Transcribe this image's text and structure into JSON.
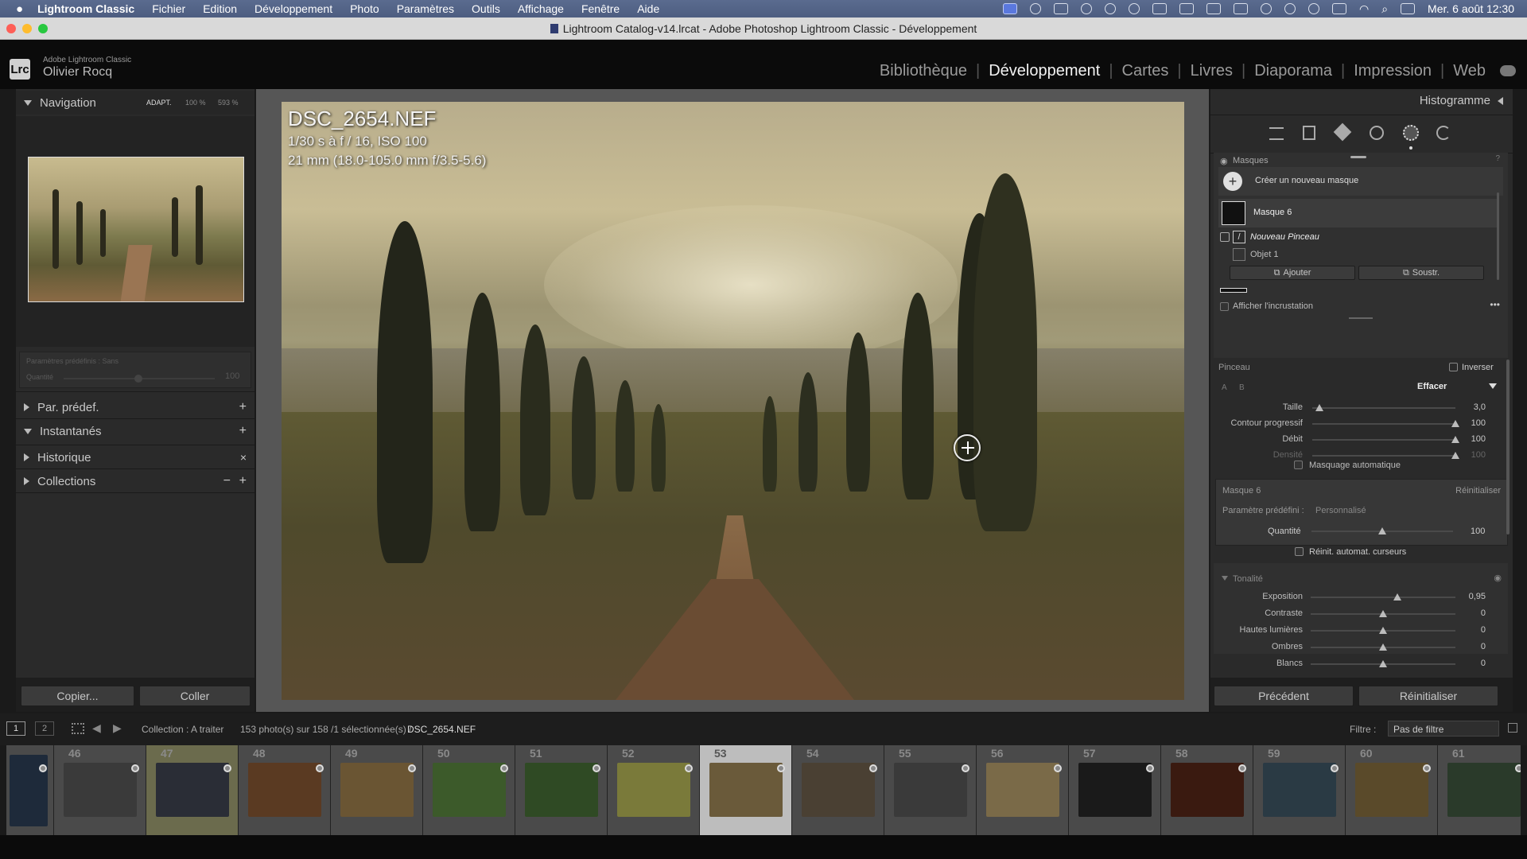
{
  "menubar": {
    "app": "Lightroom Classic",
    "items": [
      "Fichier",
      "Edition",
      "Développement",
      "Photo",
      "Paramètres",
      "Outils",
      "Affichage",
      "Fenêtre",
      "Aide"
    ],
    "clock": "Mer. 6 août  12:30"
  },
  "window": {
    "title": "Lightroom Catalog-v14.lrcat - Adobe Photoshop Lightroom Classic - Développement"
  },
  "brand": {
    "logo": "Lrc",
    "product": "Adobe Lightroom Classic",
    "user": "Olivier Rocq"
  },
  "modules": [
    "Bibliothèque",
    "Développement",
    "Cartes",
    "Livres",
    "Diaporama",
    "Impression",
    "Web"
  ],
  "active_module": "Développement",
  "left_panel": {
    "navigation": {
      "title": "Navigation",
      "zoom1": "ADAPT.",
      "zoom2": "100 %",
      "zoom3": "593 %"
    },
    "preset_dim": {
      "label": "Paramètres prédéfinis : Sans",
      "amount_label": "Quantité",
      "amount_value": "100"
    },
    "sections": [
      {
        "label": "Par. prédef.",
        "action": "+"
      },
      {
        "label": "Instantanés",
        "action": "+"
      },
      {
        "label": "Historique",
        "action": "×"
      },
      {
        "label": "Collections",
        "action": "+"
      }
    ],
    "copy_button": "Copier...",
    "paste_button": "Coller"
  },
  "photo": {
    "filename": "DSC_2654.NEF",
    "exposure": "1/30 s à f / 16, ISO 100",
    "lens": "21 mm (18.0-105.0 mm f/3.5-5.6)"
  },
  "right_panel": {
    "histogram": "Histogramme",
    "masks_title": "Masques",
    "create_mask": "Créer un nouveau masque",
    "mask_name": "Masque 6",
    "brush_name": "Nouveau Pinceau",
    "object": "Objet 1",
    "add": "Ajouter",
    "subtract": "Soustr.",
    "overlay": "Afficher l'incrustation",
    "brush": {
      "title": "Pinceau",
      "invert": "Inverser",
      "a": "A",
      "b": "B",
      "mode": "Effacer",
      "sliders": [
        {
          "label": "Taille",
          "value": "3,0",
          "pos": 0.05
        },
        {
          "label": "Contour progressif",
          "value": "100",
          "pos": 1.0
        },
        {
          "label": "Débit",
          "value": "100",
          "pos": 1.0
        },
        {
          "label": "Densité",
          "value": "100",
          "pos": 1.0
        }
      ],
      "automask": "Masquage automatique"
    },
    "mask_settings": {
      "title": "Masque 6",
      "reset": "Réinitialiser",
      "preset_label": "Paramètre prédéfini :",
      "preset_value": "Personnalisé",
      "amount_label": "Quantité",
      "amount_value": "100",
      "auto_reset": "Réinit. automat. curseurs"
    },
    "tone": {
      "title": "Tonalité",
      "sliders": [
        {
          "label": "Exposition",
          "value": "0,95",
          "pos": 0.6
        },
        {
          "label": "Contraste",
          "value": "0",
          "pos": 0.5
        },
        {
          "label": "Hautes lumières",
          "value": "0",
          "pos": 0.5
        },
        {
          "label": "Ombres",
          "value": "0",
          "pos": 0.5
        },
        {
          "label": "Blancs",
          "value": "0",
          "pos": 0.5
        }
      ]
    },
    "prev_button": "Précédent",
    "reset_button": "Réinitialiser"
  },
  "filmbar": {
    "screen1": "1",
    "screen2": "2",
    "source": "Collection : A traiter",
    "count": "153 photo(s) sur 158 /1 sélectionnée(s) /",
    "current": "DSC_2654.NEF",
    "filter_label": "Filtre :",
    "filter_value": "Pas de filtre"
  },
  "filmstrip": [
    {
      "num": "",
      "color": "#1e2a3a"
    },
    {
      "num": "46",
      "color": "#3a3a3a"
    },
    {
      "num": "47",
      "color": "#2a2d36"
    },
    {
      "num": "48",
      "color": "#5a3a22"
    },
    {
      "num": "49",
      "color": "#6a5533"
    },
    {
      "num": "50",
      "color": "#3c5a2a"
    },
    {
      "num": "51",
      "color": "#2f4a24"
    },
    {
      "num": "52",
      "color": "#7a7a3a"
    },
    {
      "num": "53",
      "color": "#6a5a3a"
    },
    {
      "num": "54",
      "color": "#4a4033"
    },
    {
      "num": "55",
      "color": "#3a3a3a"
    },
    {
      "num": "56",
      "color": "#7a6a48"
    },
    {
      "num": "57",
      "color": "#1a1a1a"
    },
    {
      "num": "58",
      "color": "#3a1a10"
    },
    {
      "num": "59",
      "color": "#2a3a44"
    },
    {
      "num": "60",
      "color": "#5a4a2a"
    },
    {
      "num": "61",
      "color": "#2a3a2a"
    }
  ]
}
